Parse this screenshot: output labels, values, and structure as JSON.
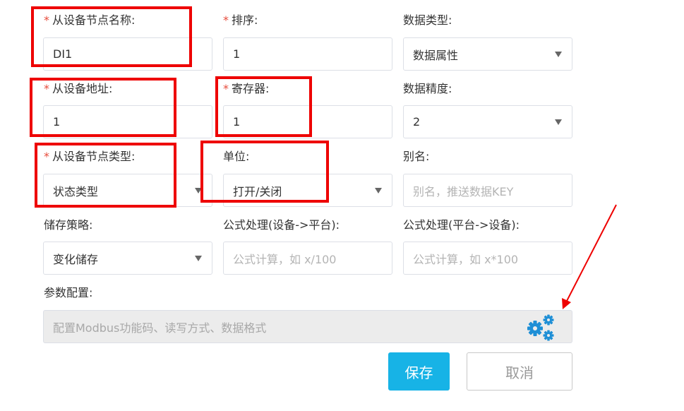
{
  "form": {
    "device_node_name": {
      "label": "从设备节点名称:",
      "required": true,
      "value": "DI1"
    },
    "sort": {
      "label": "排序:",
      "required": true,
      "value": "1"
    },
    "data_type": {
      "label": "数据类型:",
      "value": "数据属性"
    },
    "device_address": {
      "label": "从设备地址:",
      "required": true,
      "value": "1"
    },
    "register": {
      "label": "寄存器:",
      "required": true,
      "value": "1"
    },
    "data_precision": {
      "label": "数据精度:",
      "value": "2"
    },
    "device_node_type": {
      "label": "从设备节点类型:",
      "required": true,
      "value": "状态类型"
    },
    "unit": {
      "label": "单位:",
      "value": "打开/关闭"
    },
    "alias": {
      "label": "别名:",
      "placeholder": "别名，推送数据KEY"
    },
    "storage_strategy": {
      "label": "储存策略:",
      "value": "变化储存"
    },
    "formula_device_to_platform": {
      "label": "公式处理(设备->平台):",
      "placeholder": "公式计算，如 x/100"
    },
    "formula_platform_to_device": {
      "label": "公式处理(平台->设备):",
      "placeholder": "公式计算，如 x*100"
    },
    "params": {
      "label": "参数配置:",
      "placeholder": "配置Modbus功能码、读写方式、数据格式",
      "icon": "gears-icon"
    }
  },
  "buttons": {
    "save": "保存",
    "cancel": "取消"
  },
  "required_mark": "*",
  "colors": {
    "required": "#e74c3c",
    "accent": "#17b3e6",
    "gear": "#1e8fd6",
    "annotation": "#ee0000"
  }
}
